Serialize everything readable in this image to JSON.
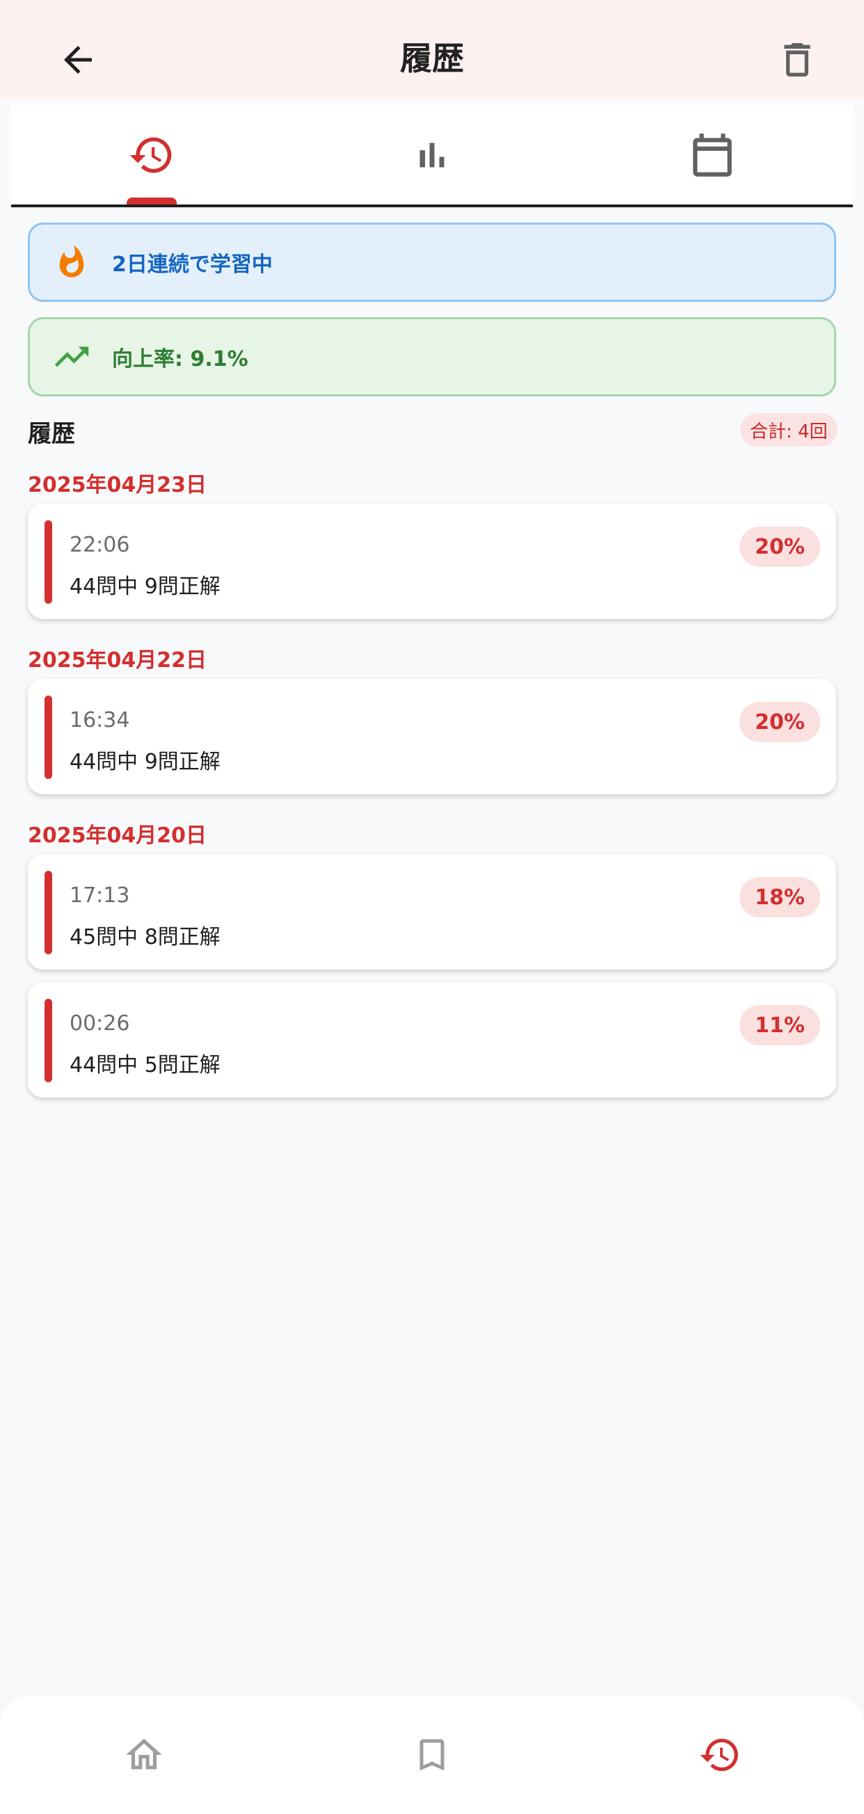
{
  "header": {
    "title": "履歴",
    "back_icon": "arrow-back-icon",
    "delete_icon": "trash-icon"
  },
  "tabs": [
    {
      "name": "history",
      "icon": "history-icon",
      "active": true
    },
    {
      "name": "stats",
      "icon": "bar-chart-icon",
      "active": false
    },
    {
      "name": "calendar",
      "icon": "calendar-icon",
      "active": false
    }
  ],
  "streak": {
    "icon": "fire-icon",
    "text": "2日連続で学習中"
  },
  "improvement": {
    "icon": "trending-up-icon",
    "text": "向上率: 9.1%"
  },
  "history": {
    "section_title": "履歴",
    "total_label": "合計: 4回",
    "groups": [
      {
        "date": "2025年04月23日",
        "items": [
          {
            "time": "22:06",
            "result": "44問中 9問正解",
            "percent": "20%"
          }
        ]
      },
      {
        "date": "2025年04月22日",
        "items": [
          {
            "time": "16:34",
            "result": "44問中 9問正解",
            "percent": "20%"
          }
        ]
      },
      {
        "date": "2025年04月20日",
        "items": [
          {
            "time": "17:13",
            "result": "45問中 8問正解",
            "percent": "18%"
          },
          {
            "time": "00:26",
            "result": "44問中 5問正解",
            "percent": "11%"
          }
        ]
      }
    ]
  },
  "bottom_nav": [
    {
      "name": "home",
      "icon": "home-icon",
      "active": false
    },
    {
      "name": "bookmark",
      "icon": "bookmark-icon",
      "active": false
    },
    {
      "name": "history",
      "icon": "history-icon",
      "active": true
    }
  ],
  "colors": {
    "accent": "#d32f2f",
    "appbar_bg": "#fdf2f0",
    "streak_bg": "#e3f0fc",
    "streak_text": "#1565c0",
    "improve_bg": "#e7f5e6",
    "improve_text": "#2e7d32",
    "inactive_icon": "#757575"
  }
}
